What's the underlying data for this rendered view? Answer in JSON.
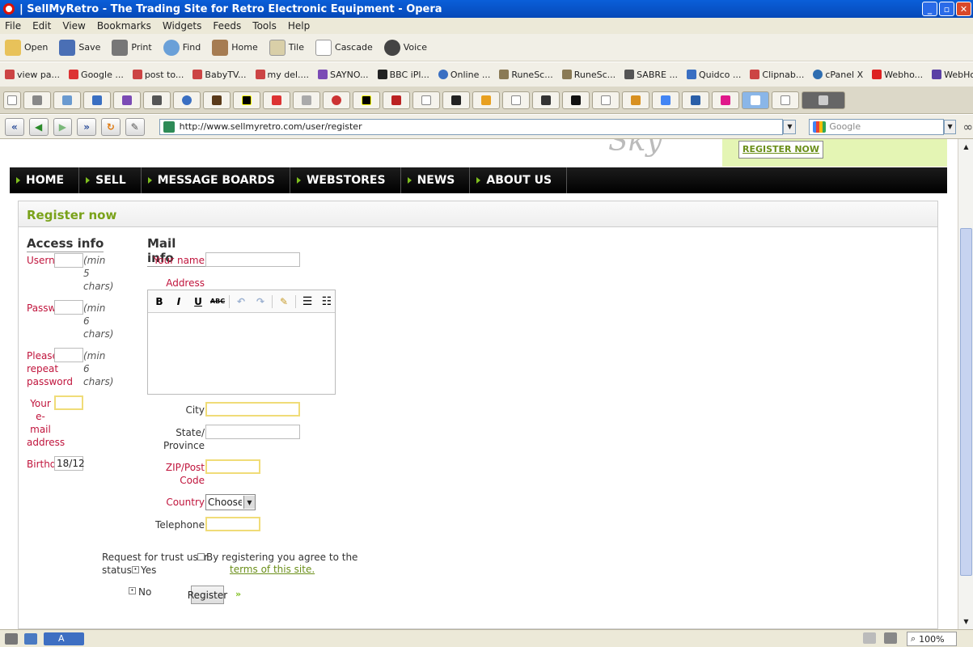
{
  "window": {
    "title": "SellMyRetro - The Trading Site for Retro Electronic Equipment - Opera",
    "title_prefix": "|"
  },
  "menu": [
    "File",
    "Edit",
    "View",
    "Bookmarks",
    "Widgets",
    "Feeds",
    "Tools",
    "Help"
  ],
  "toolbar": [
    "Open",
    "Save",
    "Print",
    "Find",
    "Home",
    "Tile",
    "Cascade",
    "Voice"
  ],
  "bookmarks": [
    "view pa...",
    "Google ...",
    "post to...",
    "BabyTV...",
    "my del....",
    "SAYNO...",
    "BBC iPl...",
    "Online ...",
    "RuneSc...",
    "RuneSc...",
    "SABRE ...",
    "Quidco ...",
    "Clipnab...",
    "cPanel X",
    "Webho...",
    "WebHo..."
  ],
  "address": {
    "url": "http://www.sellmyretro.com/user/register",
    "search_placeholder": "Google"
  },
  "header": {
    "register_now": "REGISTER NOW",
    "logo_fragment": "Sky"
  },
  "nav": [
    "HOME",
    "SELL",
    "MESSAGE BOARDS",
    "WEBSTORES",
    "NEWS",
    "ABOUT US"
  ],
  "form": {
    "panel_title": "Register now",
    "access_title": "Access info",
    "mail_title": "Mail info",
    "username_label": "Usern",
    "username_hint": [
      "(min",
      "5",
      "chars)"
    ],
    "password_label": "Passw",
    "password_hint": [
      "(min",
      "6",
      "chars)"
    ],
    "repeat_label": [
      "Please",
      "repeat",
      "password"
    ],
    "repeat_hint": [
      "(min",
      "6",
      "chars)"
    ],
    "email_label": [
      "Your",
      "e-",
      "mail",
      "address"
    ],
    "birthday_label": "Birthda",
    "birthday_value": "18/12",
    "yourname_label": "Your name",
    "address_label": "Address",
    "city_label": "City",
    "state_label": [
      "State/",
      "Province"
    ],
    "zip_label": [
      "ZIP/Post",
      "Code"
    ],
    "country_label": "Country",
    "country_value": "Choose",
    "telephone_label": "Telephone",
    "trust_label": [
      "Request for trust user",
      "status"
    ],
    "trust_yes": "Yes",
    "trust_no": "No",
    "agree_text": "By registering you agree to the",
    "terms_link": "terms of this site.",
    "register_button": "Register",
    "editor_tools": [
      "B",
      "I",
      "U",
      "ABC"
    ]
  },
  "status": {
    "mode": "A",
    "zoom": "100%"
  }
}
